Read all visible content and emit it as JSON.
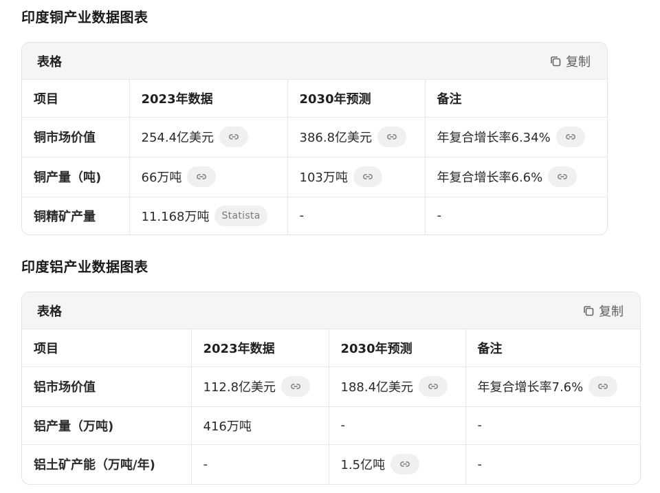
{
  "copper": {
    "section_title": "印度铜产业数据图表",
    "card_title": "表格",
    "copy_label": "复制",
    "headers": [
      "项目",
      "2023年数据",
      "2030年预测",
      "备注"
    ],
    "rows": [
      {
        "item": "铜市场价值",
        "data2023": "254.4亿美元",
        "forecast2030": "386.8亿美元",
        "note": "年复合增长率6.34%"
      },
      {
        "item": "铜产量（吨)",
        "data2023": "66万吨",
        "forecast2030": "103万吨",
        "note": "年复合增长率6.6%"
      },
      {
        "item": "铜精矿产量",
        "data2023": "11.168万吨",
        "data2023_source": "Statista",
        "forecast2030": "-",
        "note": "-"
      }
    ]
  },
  "aluminum": {
    "section_title": "印度铝产业数据图表",
    "card_title": "表格",
    "copy_label": "复制",
    "headers": [
      "项目",
      "2023年数据",
      "2030年预测",
      "备注"
    ],
    "rows": [
      {
        "item": "铝市场价值",
        "data2023": "112.8亿美元",
        "forecast2030": "188.4亿美元",
        "note": "年复合增长率7.6%"
      },
      {
        "item": "铝产量（万吨)",
        "data2023": "416万吨",
        "forecast2030": "-",
        "note": "-"
      },
      {
        "item": "铝土矿产能（万吨/年)",
        "data2023": "-",
        "forecast2030": "1.5亿吨",
        "note": "-"
      }
    ]
  },
  "icons": {
    "copy": "copy-icon",
    "link": "link-icon"
  }
}
